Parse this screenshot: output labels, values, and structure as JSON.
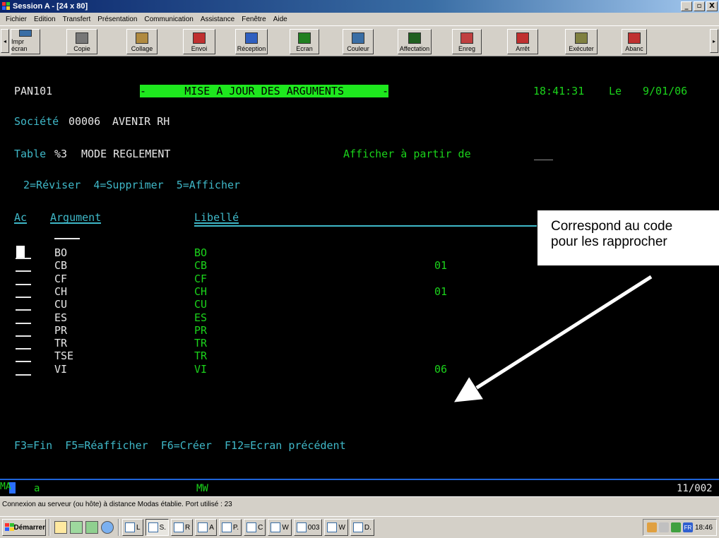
{
  "window": {
    "title": "Session A - [24 x 80]",
    "controls": {
      "minimize": "_",
      "maximize": "▫",
      "close": "X"
    }
  },
  "menu": [
    "Fichier",
    "Edition",
    "Transfert",
    "Présentation",
    "Communication",
    "Assistance",
    "Fenêtre",
    "Aide"
  ],
  "toolbar": {
    "scroll_left": "◂",
    "scroll_right": "▸",
    "buttons": [
      {
        "label": "Impr écran",
        "icon": "print-screen-icon"
      },
      {
        "label": "Copie",
        "icon": "copy-icon"
      },
      {
        "label": "Collage",
        "icon": "paste-icon"
      },
      {
        "label": "Envoi",
        "icon": "send-icon"
      },
      {
        "label": "Réception",
        "icon": "receive-icon"
      },
      {
        "label": "Ecran",
        "icon": "screen-icon"
      },
      {
        "label": "Couleur",
        "icon": "color-icon"
      },
      {
        "label": "Affectation",
        "icon": "keymap-icon"
      },
      {
        "label": "Enreg",
        "icon": "record-icon"
      },
      {
        "label": "Arrêt",
        "icon": "stop-icon"
      },
      {
        "label": "Exécuter",
        "icon": "run-icon"
      },
      {
        "label": "Abanc",
        "icon": "abandon-icon"
      }
    ]
  },
  "screen": {
    "program": "PAN101",
    "heading": "-      MISE A JOUR DES ARGUMENTS      -",
    "time": "18:41:31",
    "date_prefix": "Le",
    "date": "9/01/06",
    "company_label": "Société",
    "company_code": "00006",
    "company_name": "AVENIR RH",
    "table_label": "Table",
    "table_code": "%3",
    "table_name": "MODE REGLEMENT",
    "start_from_label": "Afficher à partir de",
    "start_from_value": "___",
    "options": "2=Réviser  4=Supprimer  5=Afficher",
    "col_ac": "Ac",
    "col_argument": "Argument",
    "col_libelle": "Libellé",
    "rows": [
      {
        "arg": "BO",
        "lib": "BO",
        "code": ""
      },
      {
        "arg": "CB",
        "lib": "CB",
        "code": "01"
      },
      {
        "arg": "CF",
        "lib": "CF",
        "code": ""
      },
      {
        "arg": "CH",
        "lib": "CH",
        "code": "01"
      },
      {
        "arg": "CU",
        "lib": "CU",
        "code": ""
      },
      {
        "arg": "ES",
        "lib": "ES",
        "code": ""
      },
      {
        "arg": "PR",
        "lib": "PR",
        "code": ""
      },
      {
        "arg": "TR",
        "lib": "TR",
        "code": ""
      },
      {
        "arg": "TSE",
        "lib": "TR",
        "code": ""
      },
      {
        "arg": "VI",
        "lib": "VI",
        "code": "06"
      }
    ],
    "fkeys": "F3=Fin  F5=Réafficher  F6=Créer  F12=Ecran précédent",
    "status_left": "MA",
    "status_session": "a",
    "status_mw": "MW",
    "cursor_pos": "11/002"
  },
  "callout": {
    "line1": "Correspond au code",
    "line2": "pour les rapprocher"
  },
  "connection_status": "Connexion au serveur (ou hôte) à distance Modas établie. Port utilisé : 23",
  "taskbar": {
    "start": "Démarrer",
    "tasks": [
      "L",
      "S.",
      "R",
      "A",
      "P.",
      "C",
      "W",
      "003",
      "W",
      "D."
    ],
    "tray_lang": "FR",
    "clock": "18:46"
  },
  "colors": {
    "terminal_green": "#1bd31b",
    "terminal_white": "#e8e8e8",
    "terminal_cyan": "#3fb8c8",
    "heading_bg": "#1ee81e",
    "titlebar": "#0a246a"
  }
}
